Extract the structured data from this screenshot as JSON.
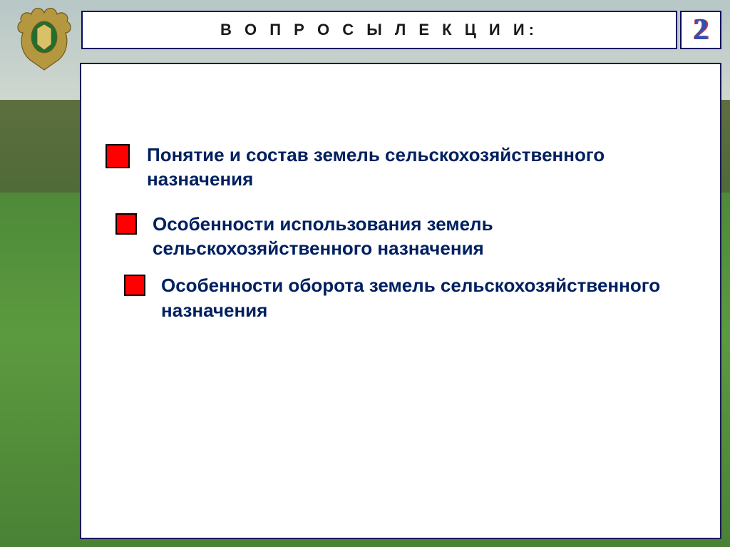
{
  "header": {
    "title": "В О П Р О С Ы    Л Е К Ц И И:"
  },
  "slide_number": "2",
  "items": [
    "Понятие и состав земель сельскохозяйственного назначения",
    "Особенности использования земель сельскохозяйственного назначения",
    "Особенности оборота земель сельскохозяйственного назначения"
  ]
}
